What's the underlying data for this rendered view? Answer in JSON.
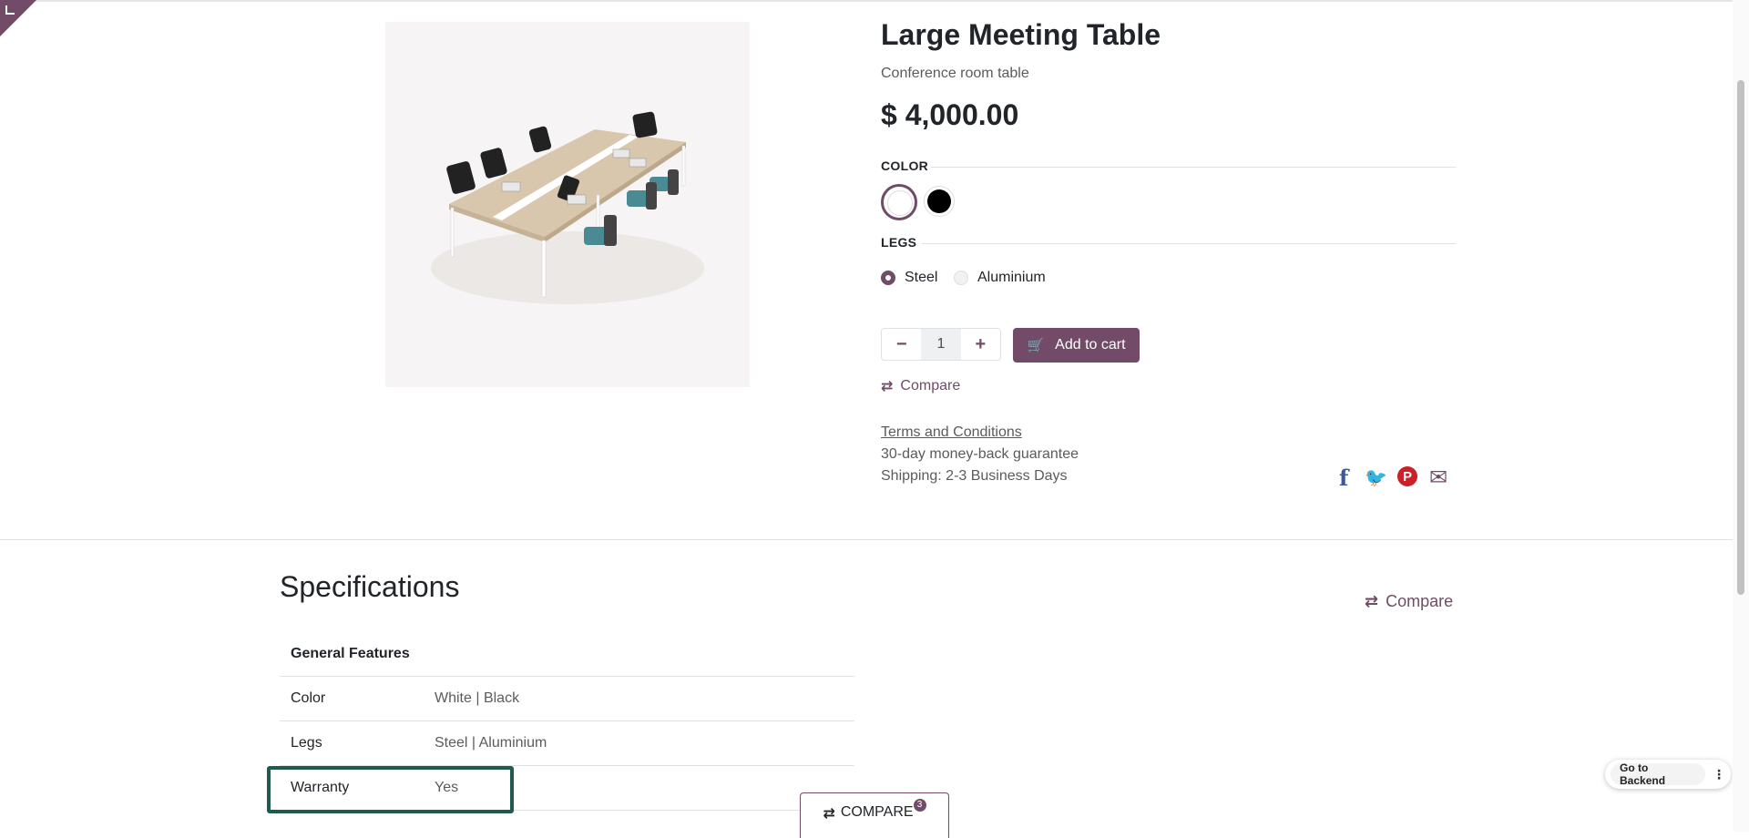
{
  "product": {
    "title": "Large Meeting Table",
    "subtitle": "Conference room table",
    "price": "$ 4,000.00",
    "image_alt": "Large meeting table with chairs"
  },
  "attributes": {
    "color": {
      "label": "COLOR",
      "options": [
        {
          "name": "White",
          "hex": "#ffffff",
          "selected": true
        },
        {
          "name": "Black",
          "hex": "#000000",
          "selected": false
        }
      ]
    },
    "legs": {
      "label": "LEGS",
      "options": [
        {
          "name": "Steel",
          "selected": true
        },
        {
          "name": "Aluminium",
          "selected": false
        }
      ]
    }
  },
  "cart": {
    "quantity": "1",
    "minus_icon": "minus-icon",
    "plus_icon": "plus-icon",
    "add_to_cart_label": "Add to cart",
    "cart_icon": "shopping-cart-icon"
  },
  "compare_label": "Compare",
  "terms": {
    "terms_link": "Terms and Conditions",
    "guarantee": "30-day money-back guarantee",
    "shipping": "Shipping: 2-3 Business Days"
  },
  "share": [
    {
      "name": "facebook-icon",
      "glyph": "f",
      "color": "#3b5998"
    },
    {
      "name": "twitter-icon",
      "glyph": "🐦",
      "color": "#55acee"
    },
    {
      "name": "pinterest-icon",
      "glyph": "P",
      "color": "#cb2027"
    },
    {
      "name": "email-icon",
      "glyph": "✉",
      "color": "#714b67"
    }
  ],
  "specifications": {
    "title": "Specifications",
    "compare_label": "Compare",
    "group": "General Features",
    "rows": [
      {
        "key": "Color",
        "value": "White | Black"
      },
      {
        "key": "Legs",
        "value": "Steel | Aluminium"
      },
      {
        "key": "Warranty",
        "value": "Yes"
      }
    ]
  },
  "compare_bar": {
    "label": "COMPARE",
    "count": "3"
  },
  "backend_widget": {
    "label": "Go to Backend"
  },
  "colors": {
    "brand": "#714b67",
    "highlight": "#1f5a4f"
  }
}
